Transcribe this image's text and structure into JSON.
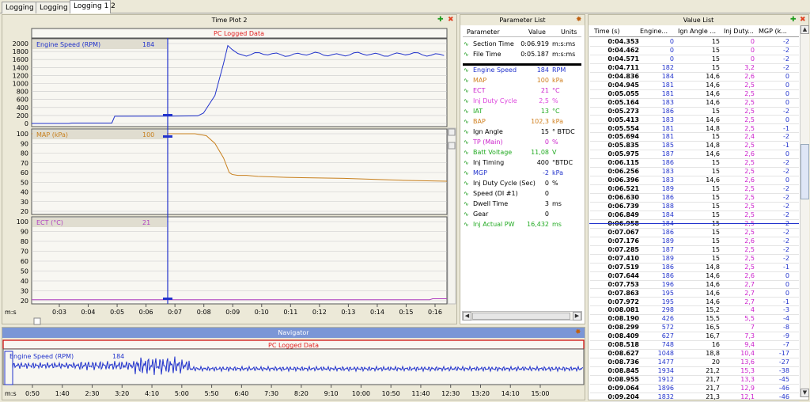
{
  "tabs": [
    "Logging 1",
    "Logging 2",
    "Logging 1 2"
  ],
  "time_plot": {
    "title": "Time Plot 2",
    "banner": "PC Logged Data",
    "charts": [
      {
        "label": "Engine Speed (RPM)",
        "value": "184",
        "color": "#2233cc",
        "ticks": [
          "2000",
          "1800",
          "1600",
          "1400",
          "1200",
          "1000",
          "800",
          "600",
          "400",
          "200",
          "0"
        ]
      },
      {
        "label": "MAP (kPa)",
        "value": "100",
        "color": "#c8801e",
        "ticks": [
          "100",
          "90",
          "80",
          "70",
          "60",
          "50",
          "40",
          "30",
          "20"
        ]
      },
      {
        "label": "ECT (°C)",
        "value": "21",
        "color": "#b040c0",
        "ticks": [
          "100",
          "90",
          "80",
          "70",
          "60",
          "50",
          "40",
          "30",
          "20"
        ]
      }
    ],
    "x_unit": "m:s",
    "x_ticks": [
      "0:03",
      "0:04",
      "0:05",
      "0:06",
      "0:07",
      "0:08",
      "0:09",
      "0:10",
      "0:11",
      "0:12",
      "0:13",
      "0:14",
      "0:15",
      "0:16"
    ]
  },
  "chart_data": [
    {
      "type": "line",
      "series": [
        {
          "name": "Engine Speed (RPM)",
          "x": [
            2.0,
            3.4,
            3.5,
            4.9,
            5.0,
            7.0,
            7.9,
            8.1,
            8.5,
            8.8,
            8.95,
            9.1,
            9.3,
            9.6,
            10.0,
            12.0,
            14.0,
            15.5,
            16.0,
            16.6
          ],
          "values": [
            0,
            0,
            10,
            10,
            180,
            184,
            190,
            260,
            700,
            1500,
            1950,
            1850,
            1750,
            1700,
            1730,
            1720,
            1760,
            1740,
            1760,
            1760
          ]
        }
      ],
      "ylim": [
        0,
        2000
      ],
      "ylabel": "Engine Speed (RPM)",
      "xlabel": "m:s"
    },
    {
      "type": "line",
      "series": [
        {
          "name": "MAP (kPa)",
          "x": [
            2.0,
            4.0,
            6.0,
            7.0,
            7.8,
            8.2,
            8.5,
            8.8,
            9.0,
            9.1,
            9.3,
            9.6,
            10.0,
            11.0,
            13.0,
            15.0,
            16.6
          ],
          "values": [
            100,
            100,
            100,
            100,
            100,
            98,
            90,
            75,
            60,
            58,
            57,
            57,
            56,
            55,
            54,
            52,
            51
          ]
        }
      ],
      "ylim": [
        20,
        100
      ],
      "ylabel": "MAP (kPa)",
      "xlabel": "m:s"
    },
    {
      "type": "line",
      "series": [
        {
          "name": "ECT (°C)",
          "x": [
            2.0,
            16.0,
            16.1,
            16.6
          ],
          "values": [
            21,
            21,
            22,
            22
          ]
        }
      ],
      "ylim": [
        20,
        100
      ],
      "ylabel": "ECT (°C)",
      "xlabel": "m:s"
    },
    {
      "type": "line",
      "series": [
        {
          "name": "Engine Speed (RPM)",
          "values": [
            184
          ]
        }
      ],
      "xlabel": "m:s"
    }
  ],
  "navigator": {
    "title": "Navigator",
    "banner": "PC Logged Data",
    "label": "Engine Speed (RPM)",
    "value": "184",
    "x_unit": "m:s",
    "x_ticks": [
      "0:50",
      "1:40",
      "2:30",
      "3:20",
      "4:10",
      "5:00",
      "5:50",
      "6:40",
      "7:30",
      "8:20",
      "9:10",
      "10:00",
      "10:50",
      "11:40",
      "12:30",
      "13:20",
      "14:10",
      "15:00"
    ]
  },
  "parameter_list": {
    "title": "Parameter List",
    "headers": [
      "Parameter",
      "Value",
      "Units"
    ],
    "rows": [
      {
        "name": "Section Time",
        "value": "0:06.919",
        "unit": "m:s:ms",
        "color": "#000000"
      },
      {
        "name": "File Time",
        "value": "0:05.187",
        "unit": "m:s:ms",
        "color": "#000000"
      },
      {
        "name": "Engine Speed",
        "value": "184",
        "unit": "RPM",
        "color": "#2233cc"
      },
      {
        "name": "MAP",
        "value": "100",
        "unit": "kPa",
        "color": "#d08020"
      },
      {
        "name": "ECT",
        "value": "21",
        "unit": "°C",
        "color": "#cc22cc"
      },
      {
        "name": "Inj Duty Cycle",
        "value": "2,5",
        "unit": "%",
        "color": "#dd44dd"
      },
      {
        "name": "IAT",
        "value": "13",
        "unit": "°C",
        "color": "#22aa22"
      },
      {
        "name": "BAP",
        "value": "102,3",
        "unit": "kPa",
        "color": "#d08020"
      },
      {
        "name": "Ign Angle",
        "value": "15",
        "unit": "° BTDC",
        "color": "#000000"
      },
      {
        "name": "TP (Main)",
        "value": "0",
        "unit": "%",
        "color": "#cc22cc"
      },
      {
        "name": "Batt Voltage",
        "value": "11,08",
        "unit": "V",
        "color": "#22aa22"
      },
      {
        "name": "Inj Timing",
        "value": "400",
        "unit": "°BTDC",
        "color": "#000000"
      },
      {
        "name": "MGP",
        "value": "-2",
        "unit": "kPa",
        "color": "#2233cc"
      },
      {
        "name": "Inj Duty Cycle (Sec)",
        "value": "0",
        "unit": "%",
        "color": "#000000"
      },
      {
        "name": "Speed (DI #1)",
        "value": "0",
        "unit": "",
        "color": "#000000"
      },
      {
        "name": "Dwell Time",
        "value": "3",
        "unit": "ms",
        "color": "#000000"
      },
      {
        "name": "Gear",
        "value": "0",
        "unit": "",
        "color": "#000000"
      },
      {
        "name": "Inj Actual PW",
        "value": "16,432",
        "unit": "ms",
        "color": "#22aa22"
      }
    ]
  },
  "value_list": {
    "title": "Value List",
    "headers": [
      "Time (s)",
      "Engine...",
      "Ign Angle ...",
      "Inj Duty...",
      "MGP (k..."
    ],
    "rows": [
      [
        "0:04.353",
        "0",
        "15",
        "0",
        "-2"
      ],
      [
        "0:04.462",
        "0",
        "15",
        "0",
        "-2"
      ],
      [
        "0:04.571",
        "0",
        "15",
        "0",
        "-2"
      ],
      [
        "0:04.711",
        "182",
        "15",
        "3,2",
        "-2"
      ],
      [
        "0:04.836",
        "184",
        "14,6",
        "2,6",
        "0"
      ],
      [
        "0:04.945",
        "181",
        "14,6",
        "2,5",
        "0"
      ],
      [
        "0:05.055",
        "181",
        "14,6",
        "2,5",
        "0"
      ],
      [
        "0:05.164",
        "183",
        "14,6",
        "2,5",
        "0"
      ],
      [
        "0:05.273",
        "186",
        "15",
        "2,5",
        "-2"
      ],
      [
        "0:05.413",
        "183",
        "14,6",
        "2,5",
        "0"
      ],
      [
        "0:05.554",
        "181",
        "14,8",
        "2,5",
        "-1"
      ],
      [
        "0:05.694",
        "181",
        "15",
        "2,4",
        "-2"
      ],
      [
        "0:05.835",
        "185",
        "14,8",
        "2,5",
        "-1"
      ],
      [
        "0:05.975",
        "187",
        "14,6",
        "2,6",
        "0"
      ],
      [
        "0:06.115",
        "186",
        "15",
        "2,5",
        "-2"
      ],
      [
        "0:06.256",
        "183",
        "15",
        "2,5",
        "-2"
      ],
      [
        "0:06.396",
        "183",
        "14,6",
        "2,6",
        "0"
      ],
      [
        "0:06.521",
        "189",
        "15",
        "2,5",
        "-2"
      ],
      [
        "0:06.630",
        "186",
        "15",
        "2,5",
        "-2"
      ],
      [
        "0:06.739",
        "188",
        "15",
        "2,5",
        "-2"
      ],
      [
        "0:06.849",
        "184",
        "15",
        "2,5",
        "-2"
      ],
      [
        "0:06.958",
        "184",
        "15",
        "2,5",
        "-2"
      ],
      [
        "0:07.067",
        "186",
        "15",
        "2,5",
        "-2"
      ],
      [
        "0:07.176",
        "189",
        "15",
        "2,6",
        "-2"
      ],
      [
        "0:07.285",
        "187",
        "15",
        "2,5",
        "-2"
      ],
      [
        "0:07.410",
        "189",
        "15",
        "2,5",
        "-2"
      ],
      [
        "0:07.519",
        "186",
        "14,8",
        "2,5",
        "-1"
      ],
      [
        "0:07.644",
        "186",
        "14,6",
        "2,6",
        "0"
      ],
      [
        "0:07.753",
        "196",
        "14,6",
        "2,7",
        "0"
      ],
      [
        "0:07.863",
        "195",
        "14,6",
        "2,7",
        "0"
      ],
      [
        "0:07.972",
        "195",
        "14,6",
        "2,7",
        "-1"
      ],
      [
        "0:08.081",
        "298",
        "15,2",
        "4",
        "-3"
      ],
      [
        "0:08.190",
        "426",
        "15,5",
        "5,5",
        "-4"
      ],
      [
        "0:08.299",
        "572",
        "16,5",
        "7",
        "-8"
      ],
      [
        "0:08.409",
        "627",
        "16,7",
        "7,3",
        "-9"
      ],
      [
        "0:08.518",
        "748",
        "16",
        "9,4",
        "-7"
      ],
      [
        "0:08.627",
        "1048",
        "18,8",
        "10,4",
        "-17"
      ],
      [
        "0:08.736",
        "1477",
        "20",
        "13,6",
        "-27"
      ],
      [
        "0:08.845",
        "1934",
        "21,2",
        "15,3",
        "-38"
      ],
      [
        "0:08.955",
        "1912",
        "21,7",
        "13,3",
        "-45"
      ],
      [
        "0:09.064",
        "1896",
        "21,7",
        "12,9",
        "-46"
      ],
      [
        "0:09.204",
        "1832",
        "21,3",
        "12,1",
        "-46"
      ]
    ]
  }
}
